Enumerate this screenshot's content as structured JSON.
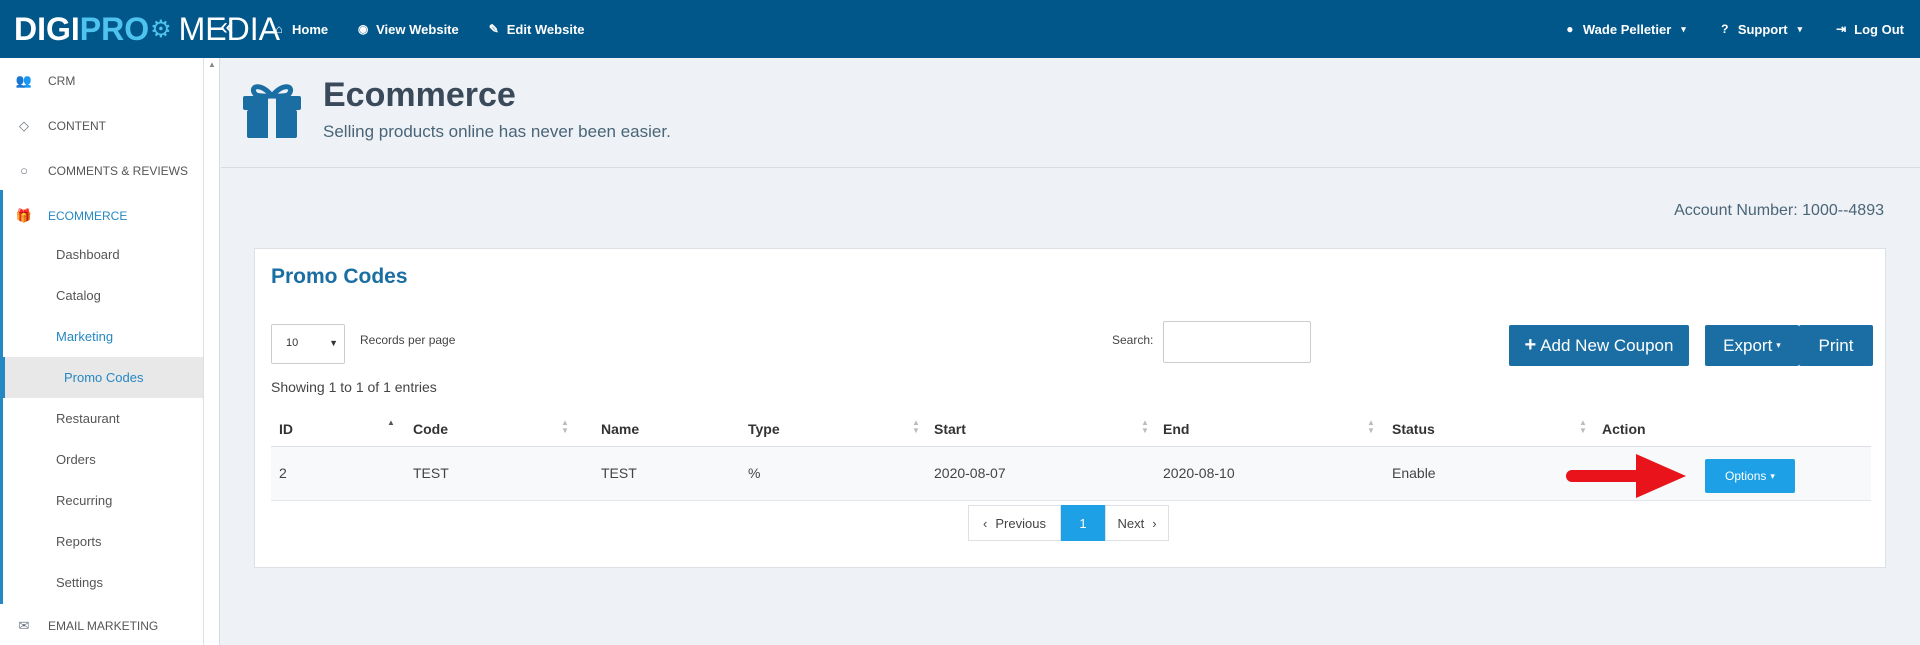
{
  "brand": {
    "part1": "DIGI",
    "part2": "PRO",
    "part3": "MEDIA"
  },
  "topnav": [
    {
      "label": "Home",
      "icon": "home-icon"
    },
    {
      "label": "View Website",
      "icon": "eye-icon"
    },
    {
      "label": "Edit Website",
      "icon": "edit-icon"
    }
  ],
  "topright": {
    "user": "Wade Pelletier",
    "support": "Support",
    "logout": "Log Out"
  },
  "sidebar": {
    "items": [
      {
        "label": "CRM",
        "icon": "users-icon"
      },
      {
        "label": "CONTENT",
        "icon": "diamond-icon"
      },
      {
        "label": "COMMENTS & REVIEWS",
        "icon": "comment-icon"
      },
      {
        "label": "ECOMMERCE",
        "icon": "gift-icon"
      },
      {
        "label": "EMAIL MARKETING",
        "icon": "envelope-icon"
      }
    ],
    "sub": [
      "Dashboard",
      "Catalog",
      "Marketing",
      "Restaurant",
      "Orders",
      "Recurring",
      "Reports",
      "Settings"
    ],
    "subsub": "Promo Codes"
  },
  "page": {
    "title": "Ecommerce",
    "subtitle": "Selling products online has never been easier."
  },
  "account": "Account Number: 1000--4893",
  "panel": {
    "title": "Promo Codes",
    "length_value": "10",
    "length_label": "Records per page",
    "search_label": "Search:",
    "add_label": "Add New Coupon",
    "export_label": "Export",
    "print_label": "Print",
    "showing": "Showing 1 to 1 of 1 entries"
  },
  "table": {
    "headers": [
      "ID",
      "Code",
      "Name",
      "Type",
      "Start",
      "End",
      "Status",
      "Action"
    ],
    "rows": [
      {
        "id": "2",
        "code": "TEST",
        "name": "TEST",
        "type": "%",
        "start": "2020-08-07",
        "end": "2020-08-10",
        "status": "Enable",
        "action": "Options"
      }
    ]
  },
  "pager": {
    "prev": "Previous",
    "page": "1",
    "next": "Next"
  },
  "colors": {
    "topbar": "#02578a",
    "accent": "#1a6ea3",
    "options": "#1ea0e6",
    "annotation_arrow": "#e8131b"
  }
}
